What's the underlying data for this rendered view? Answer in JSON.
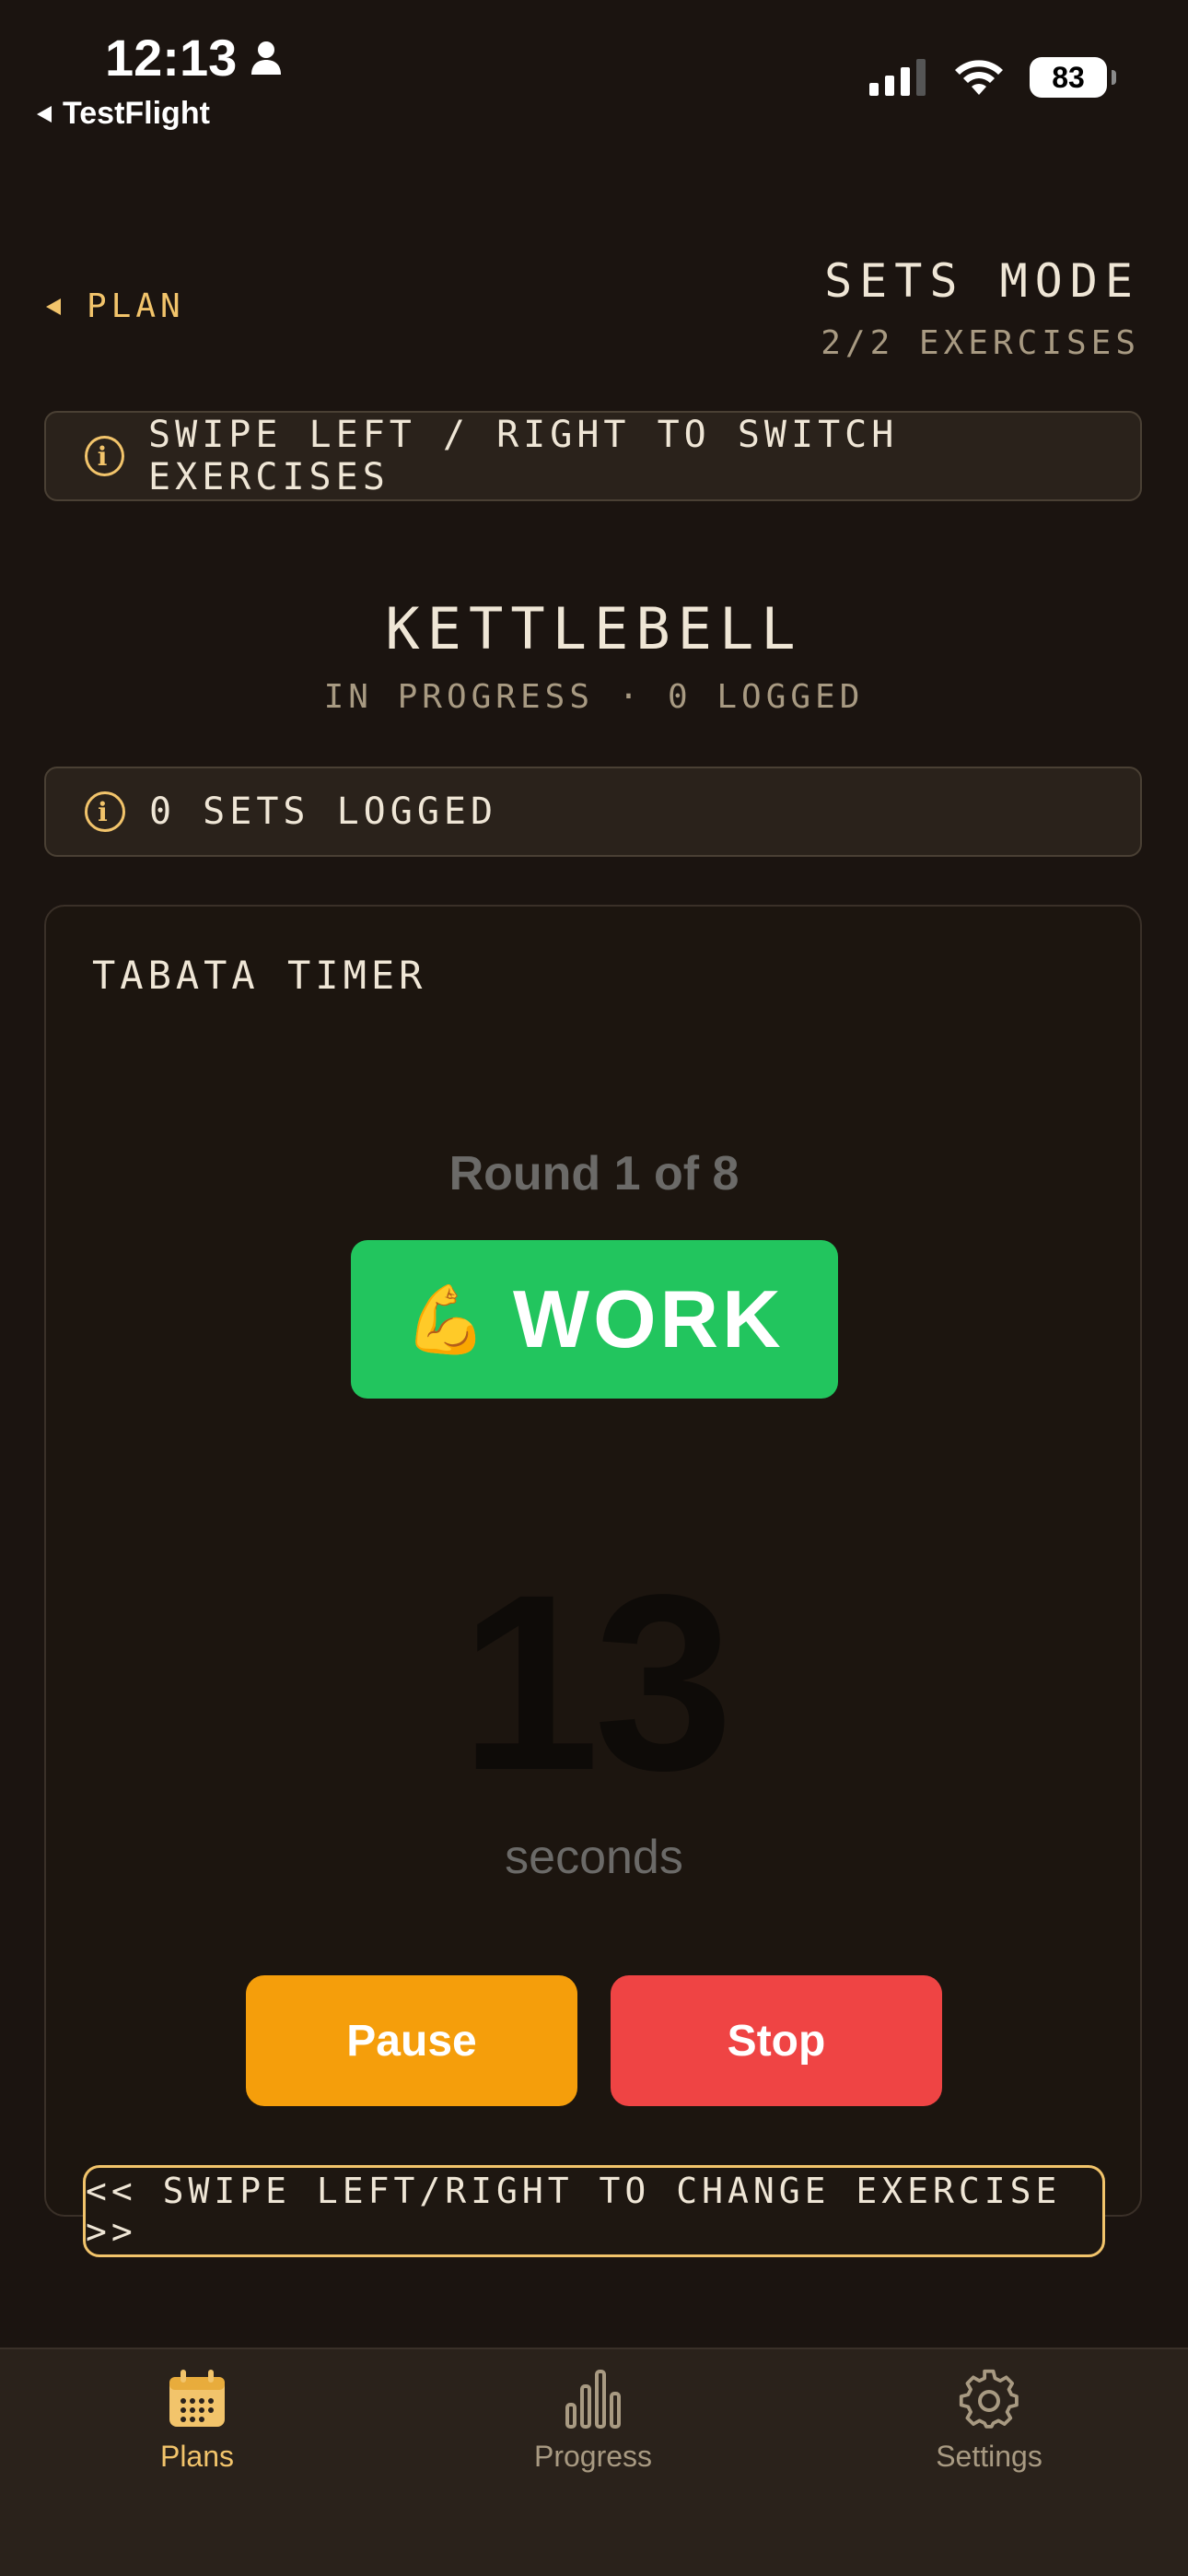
{
  "status_bar": {
    "time": "12:13",
    "back_app": "TestFlight",
    "battery": "83"
  },
  "header": {
    "back_label": "PLAN",
    "mode_title": "SETS MODE",
    "exercise_count": "2/2 EXERCISES"
  },
  "hint_top": "SWIPE LEFT / RIGHT TO SWITCH EXERCISES",
  "exercise": {
    "name": "KETTLEBELL",
    "status": "IN PROGRESS · 0 LOGGED",
    "sets_logged": "0 SETS LOGGED"
  },
  "timer": {
    "title": "TABATA TIMER",
    "round": "Round 1 of 8",
    "phase_emoji": "💪",
    "phase_label": "WORK",
    "countdown": "13",
    "unit": "seconds",
    "pause_label": "Pause",
    "stop_label": "Stop"
  },
  "swipe_banner": "<< SWIPE LEFT/RIGHT TO CHANGE EXERCISE >>",
  "tabs": [
    {
      "label": "Plans",
      "icon": "calendar-icon",
      "active": true
    },
    {
      "label": "Progress",
      "icon": "bar-chart-icon",
      "active": false
    },
    {
      "label": "Settings",
      "icon": "gear-icon",
      "active": false
    }
  ],
  "colors": {
    "background": "#1b1410",
    "accent": "#f2c46b",
    "work_green": "#22c55e",
    "pause_orange": "#f59e0b",
    "stop_red": "#ef4444"
  }
}
